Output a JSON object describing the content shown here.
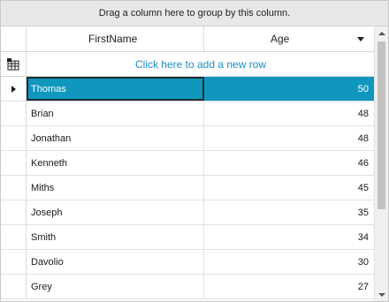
{
  "group_panel": {
    "text": "Drag a column here to group by this column."
  },
  "columns": {
    "first_name": "FirstName",
    "age": "Age"
  },
  "new_row": {
    "text": "Click here to add a new row"
  },
  "rows": [
    {
      "first_name": "Thomas",
      "age": "50",
      "selected": true
    },
    {
      "first_name": "Brian",
      "age": "48"
    },
    {
      "first_name": "Jonathan",
      "age": "48"
    },
    {
      "first_name": "Kenneth",
      "age": "46"
    },
    {
      "first_name": "Miths",
      "age": "45"
    },
    {
      "first_name": "Joseph",
      "age": "35"
    },
    {
      "first_name": "Smith",
      "age": "34"
    },
    {
      "first_name": "Davolio",
      "age": "30"
    },
    {
      "first_name": "Grey",
      "age": "27"
    }
  ],
  "colors": {
    "selection": "#1097bd",
    "new_row_link": "#1b8ec2",
    "group_panel": "#e8e8e8"
  },
  "icons": {
    "new_row": "add-row-icon",
    "current_row": "current-row-indicator-icon",
    "sort": "sort-descending-icon"
  }
}
